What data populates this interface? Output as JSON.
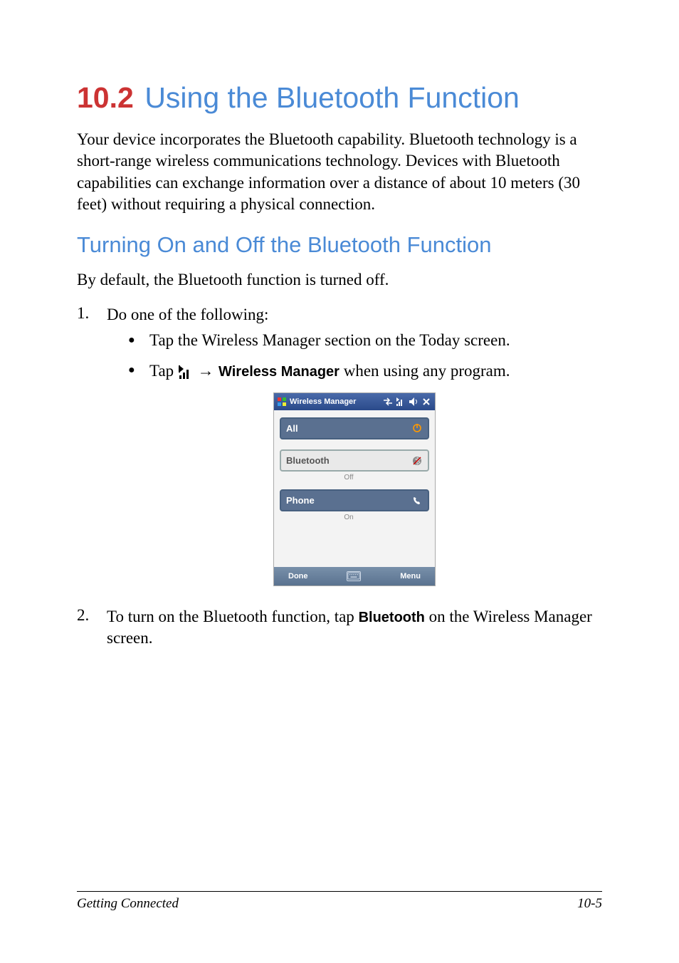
{
  "section": {
    "number": "10.2",
    "title": "Using the Bluetooth Function"
  },
  "intro": "Your device incorporates the Bluetooth capability. Bluetooth technology is a short-range wireless communications technology. Devices with Bluetooth capabilities can exchange information over a distance of about 10 meters (30 feet) without requiring a physical connection.",
  "subhead": "Turning On and Off the Bluetooth Function",
  "p1": "By default, the Bluetooth function is turned off.",
  "step1_num": "1.",
  "step1_text": "Do one of the following:",
  "bullet1": "Tap the Wireless Manager section on the Today screen.",
  "bullet2_pre": "Tap ",
  "bullet2_arrow": " → ",
  "bullet2_bold": "Wireless Manager",
  "bullet2_post": " when using any program.",
  "step2_num": "2.",
  "step2_pre": "To turn on the Bluetooth function, tap ",
  "step2_bold": "Bluetooth",
  "step2_post": " on the Wireless Manager screen.",
  "screenshot": {
    "title": "Wireless Manager",
    "rows": {
      "all": {
        "label": "All"
      },
      "bluetooth": {
        "label": "Bluetooth",
        "status": "Off"
      },
      "phone": {
        "label": "Phone",
        "status": "On"
      }
    },
    "softkeys": {
      "left": "Done",
      "right": "Menu"
    }
  },
  "footer": {
    "chapter": "Getting Connected",
    "page": "10-5"
  }
}
